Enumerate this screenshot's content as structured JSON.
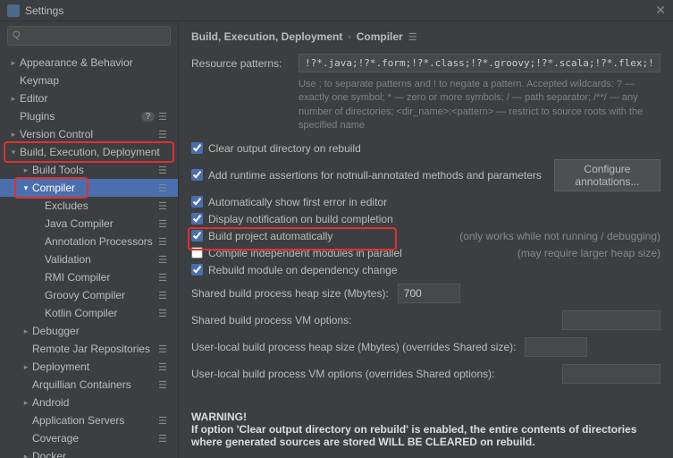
{
  "title": "Settings",
  "search_placeholder": "",
  "sidebar": {
    "items": [
      {
        "label": "Appearance & Behavior",
        "chev": ">",
        "indent": 0
      },
      {
        "label": "Keymap",
        "chev": "",
        "indent": 0
      },
      {
        "label": "Editor",
        "chev": ">",
        "indent": 0
      },
      {
        "label": "Plugins",
        "chev": "",
        "indent": 0,
        "badge": "?",
        "menu": true
      },
      {
        "label": "Version Control",
        "chev": ">",
        "indent": 0,
        "menu": true
      },
      {
        "label": "Build, Execution, Deployment",
        "chev": "v",
        "indent": 0,
        "highlight": "bed"
      },
      {
        "label": "Build Tools",
        "chev": ">",
        "indent": 1,
        "menu": true
      },
      {
        "label": "Compiler",
        "chev": "v",
        "indent": 1,
        "selected": true,
        "menu": true,
        "highlight": "comp"
      },
      {
        "label": "Excludes",
        "chev": "",
        "indent": 2,
        "menu": true
      },
      {
        "label": "Java Compiler",
        "chev": "",
        "indent": 2,
        "menu": true
      },
      {
        "label": "Annotation Processors",
        "chev": "",
        "indent": 2,
        "menu": true
      },
      {
        "label": "Validation",
        "chev": "",
        "indent": 2,
        "menu": true
      },
      {
        "label": "RMI Compiler",
        "chev": "",
        "indent": 2,
        "menu": true
      },
      {
        "label": "Groovy Compiler",
        "chev": "",
        "indent": 2,
        "menu": true
      },
      {
        "label": "Kotlin Compiler",
        "chev": "",
        "indent": 2,
        "menu": true
      },
      {
        "label": "Debugger",
        "chev": ">",
        "indent": 1
      },
      {
        "label": "Remote Jar Repositories",
        "chev": "",
        "indent": 1,
        "menu": true
      },
      {
        "label": "Deployment",
        "chev": ">",
        "indent": 1,
        "menu": true
      },
      {
        "label": "Arquillian Containers",
        "chev": "",
        "indent": 1,
        "menu": true
      },
      {
        "label": "Android",
        "chev": ">",
        "indent": 1
      },
      {
        "label": "Application Servers",
        "chev": "",
        "indent": 1,
        "menu": true
      },
      {
        "label": "Coverage",
        "chev": "",
        "indent": 1,
        "menu": true
      },
      {
        "label": "Docker",
        "chev": ">",
        "indent": 1
      }
    ]
  },
  "breadcrumb": [
    "Build, Execution, Deployment",
    "Compiler"
  ],
  "resource_patterns": {
    "label": "Resource patterns:",
    "value": "!?*.java;!?*.form;!?*.class;!?*.groovy;!?*.scala;!?*.flex;!?*.kt;!?*.clj;!?*.aj",
    "help": "Use ; to separate patterns and ! to negate a pattern. Accepted wildcards: ? — exactly one symbol; * — zero or more symbols; / — path separator; /**/ — any number of directories; <dir_name>:<pattern> — restrict to source roots with the specified name"
  },
  "checks": [
    {
      "label": "Clear output directory on rebuild",
      "checked": true
    },
    {
      "label": "Add runtime assertions for notnull-annotated methods and parameters",
      "checked": true,
      "button": "Configure annotations..."
    },
    {
      "label": "Automatically show first error in editor",
      "checked": true
    },
    {
      "label": "Display notification on build completion",
      "checked": true
    },
    {
      "label": "Build project automatically",
      "checked": true,
      "note": "(only works while not running / debugging)",
      "highlight": true
    },
    {
      "label": "Compile independent modules in parallel",
      "checked": false,
      "note": "(may require larger heap size)"
    },
    {
      "label": "Rebuild module on dependency change",
      "checked": true
    }
  ],
  "fields": [
    {
      "label": "Shared build process heap size (Mbytes):",
      "value": "700",
      "w": "w70"
    },
    {
      "label": "Shared build process VM options:",
      "value": "",
      "w": "w110",
      "flex": true
    },
    {
      "label": "User-local build process heap size (Mbytes) (overrides Shared size):",
      "value": "",
      "w": "w70"
    },
    {
      "label": "User-local build process VM options (overrides Shared options):",
      "value": "",
      "w": "w110",
      "flex": true
    }
  ],
  "warning": {
    "title": "WARNING!",
    "text": "If option 'Clear output directory on rebuild' is enabled, the entire contents of directories where generated sources are stored WILL BE CLEARED on rebuild."
  }
}
